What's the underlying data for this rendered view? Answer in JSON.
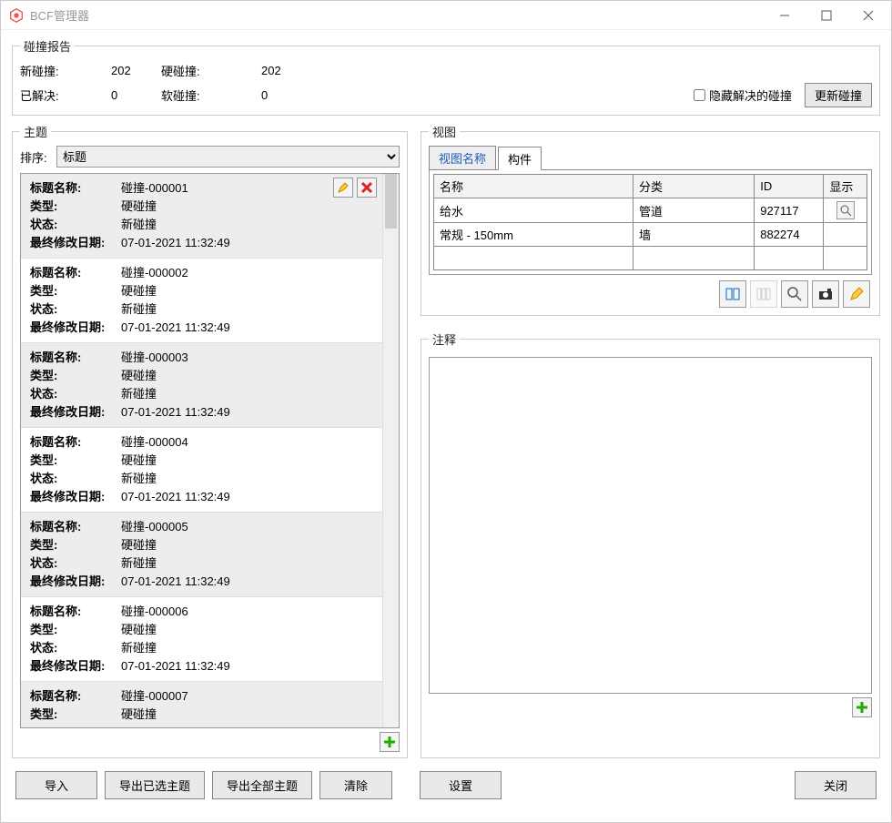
{
  "window": {
    "title": "BCF管理器"
  },
  "report": {
    "legend": "碰撞报告",
    "new_label": "新碰撞:",
    "new_val": "202",
    "hard_label": "硬碰撞:",
    "hard_val": "202",
    "solved_label": "已解决:",
    "solved_val": "0",
    "soft_label": "软碰撞:",
    "soft_val": "0",
    "hide_solved": "隐藏解决的碰撞",
    "update_btn": "更新碰撞"
  },
  "topics": {
    "legend": "主题",
    "sort_label": "排序:",
    "sort_value": "标题",
    "field_labels": {
      "name": "标题名称:",
      "type": "类型:",
      "status": "状态:",
      "date": "最终修改日期:"
    },
    "items": [
      {
        "name": "碰撞-000001",
        "type": "硬碰撞",
        "status": "新碰撞",
        "date": "07-01-2021 11:32:49",
        "selected": true
      },
      {
        "name": "碰撞-000002",
        "type": "硬碰撞",
        "status": "新碰撞",
        "date": "07-01-2021 11:32:49"
      },
      {
        "name": "碰撞-000003",
        "type": "硬碰撞",
        "status": "新碰撞",
        "date": "07-01-2021 11:32:49"
      },
      {
        "name": "碰撞-000004",
        "type": "硬碰撞",
        "status": "新碰撞",
        "date": "07-01-2021 11:32:49"
      },
      {
        "name": "碰撞-000005",
        "type": "硬碰撞",
        "status": "新碰撞",
        "date": "07-01-2021 11:32:49"
      },
      {
        "name": "碰撞-000006",
        "type": "硬碰撞",
        "status": "新碰撞",
        "date": "07-01-2021 11:32:49"
      },
      {
        "name": "碰撞-000007",
        "type": "硬碰撞"
      }
    ]
  },
  "views": {
    "legend": "视图",
    "tabs": {
      "name": "视图名称",
      "component": "构件"
    },
    "headers": {
      "name": "名称",
      "category": "分类",
      "id": "ID",
      "show": "显示"
    },
    "rows": [
      {
        "name": "给水",
        "category": "管道",
        "id": "927117",
        "show_icon": true
      },
      {
        "name": "常规 - 150mm",
        "category": "墙",
        "id": "882274"
      }
    ]
  },
  "notes": {
    "legend": "注释"
  },
  "buttons": {
    "import": "导入",
    "export_sel": "导出已选主题",
    "export_all": "导出全部主题",
    "clear": "清除",
    "settings": "设置",
    "close": "关闭"
  }
}
